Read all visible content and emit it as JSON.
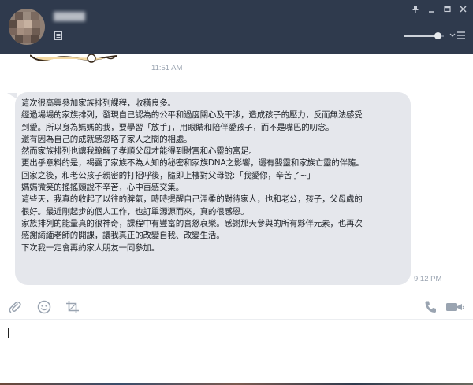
{
  "header": {
    "contact_name": "",
    "icons": [
      "avatar",
      "note-icon",
      "pin-icon",
      "minimize-icon",
      "maximize-icon",
      "close-icon",
      "volume-slider",
      "menu-icon"
    ],
    "volume_level": 0.85
  },
  "chat": {
    "messages": [
      {
        "type": "sticker",
        "time": "11:51 AM"
      },
      {
        "type": "text",
        "time": "9:12 PM",
        "lines": [
          "這次很高興參加家族排列課程，收穫良多。",
          "經過場場的家族排列，發現自己認為的公平和過度關心及干涉，造成孩子的壓力，反而無法感受",
          "到愛。所以身為媽媽的我，要學習「放手」，用眼睛和陪伴愛孩子，而不是嘴巴的叨念。",
          "還有因為自己的成就感忽略了家人之間的相處。",
          "然而家族排列也讓我瞭解了孝順父母才能得到財富和心靈的富足。",
          "更出乎意料的是，褐露了家族不為人知的秘密和家族DNA之影響，還有嬰靈和家族亡靈的伴隨。",
          "回家之後，和老公孩子親密的打招呼後，隨即上樓對父母說:「我愛你，辛苦了~」",
          "媽媽微笑的搖搖頭說不辛苦，心中百感交集。",
          "這些天，我真的收起了以往的脾氣，時時提醒自己溫柔的對待家人，也和老公，孩子，父母處的",
          "很好。最近剛起步的個人工作，也訂單源源而來，真的很感恩。",
          "家族排列的能量真的很神奇，課程中有豐富的喜怒哀樂。感謝那天參與的所有夥伴元素，也再次",
          "感謝綺緬老師的開課，讓我真正的改變自我、改變生活。",
          "下次我一定會再約家人朋友一同參加。"
        ]
      }
    ]
  },
  "toolbar": {
    "icons": [
      "attach-icon",
      "emoji-icon",
      "crop-icon",
      "phone-icon",
      "video-icon"
    ]
  },
  "composer": {
    "value": ""
  },
  "colors": {
    "header_bg": "#2f3a4d",
    "bubble_bg": "#e5e7ec",
    "time_text": "#9aa4b1",
    "icon_gray": "#9aa4b1"
  }
}
